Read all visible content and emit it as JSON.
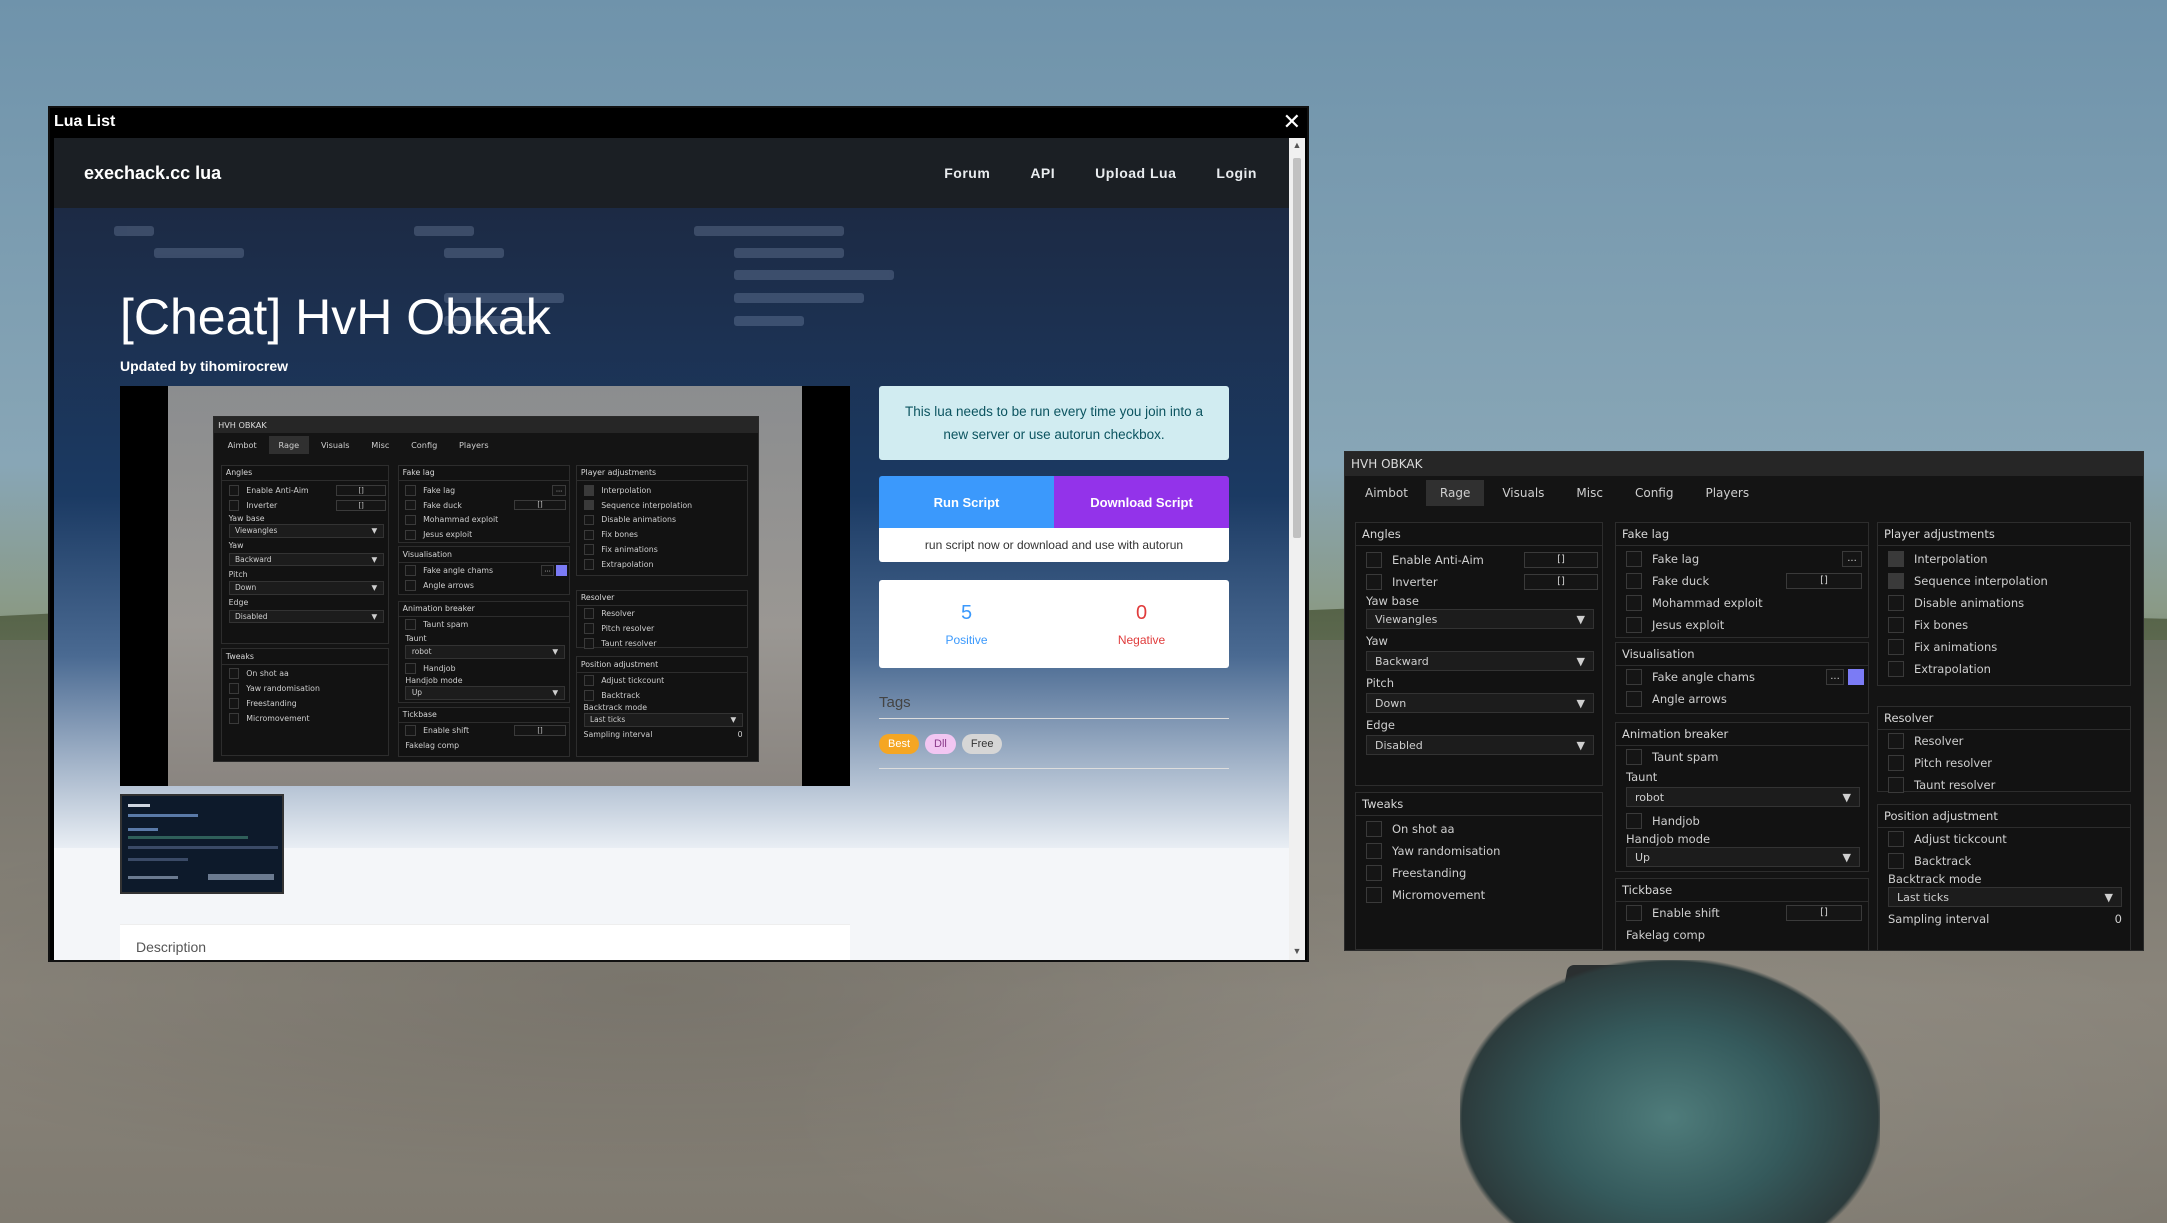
{
  "window": {
    "title": "Lua List"
  },
  "site": {
    "brand": "exechack.cc lua",
    "nav": [
      "Forum",
      "API",
      "Upload Lua",
      "Login"
    ],
    "script_title": "[Cheat] HvH Obkak",
    "updated_by": "Updated by tihomirocrew",
    "notice": "This lua needs to be run every time you join into a new server or use autorun checkbox.",
    "run_label": "Run Script",
    "download_label": "Download Script",
    "run_note": "run script now or download and use with autorun",
    "positive_count": "5",
    "positive_label": "Positive",
    "negative_count": "0",
    "negative_label": "Negative",
    "tags_title": "Tags",
    "tags": [
      {
        "label": "Best",
        "bg": "#f5a623",
        "fg": "#ffffff"
      },
      {
        "label": "Dll",
        "bg": "#f2c6f2",
        "fg": "#8a3a8a"
      },
      {
        "label": "Free",
        "bg": "#d6d6d6",
        "fg": "#333333"
      }
    ],
    "description_title": "Description"
  },
  "menu": {
    "title": "HVH OBKAK",
    "tabs": [
      "Aimbot",
      "Rage",
      "Visuals",
      "Misc",
      "Config",
      "Players"
    ],
    "active_tab": "Rage",
    "angles": {
      "title": "Angles",
      "enable_antiaim": "Enable Anti-Aim",
      "inverter": "Inverter",
      "yaw_base_label": "Yaw base",
      "yaw_base_value": "Viewangles",
      "yaw_label": "Yaw",
      "yaw_value": "Backward",
      "pitch_label": "Pitch",
      "pitch_value": "Down",
      "edge_label": "Edge",
      "edge_value": "Disabled"
    },
    "tweaks": {
      "title": "Tweaks",
      "items": [
        "On shot aa",
        "Yaw randomisation",
        "Freestanding",
        "Micromovement"
      ]
    },
    "fakelag": {
      "title": "Fake lag",
      "items": [
        "Fake lag",
        "Fake duck",
        "Mohammad exploit",
        "Jesus exploit"
      ]
    },
    "visualisation": {
      "title": "Visualisation",
      "items": [
        "Fake angle chams",
        "Angle arrows"
      ]
    },
    "animation_breaker": {
      "title": "Animation breaker",
      "taunt_spam": "Taunt spam",
      "taunt_label": "Taunt",
      "taunt_value": "robot",
      "handjob": "Handjob",
      "handjob_mode_label": "Handjob mode",
      "handjob_mode_value": "Up"
    },
    "tickbase": {
      "title": "Tickbase",
      "enable_shift": "Enable shift",
      "fakelag_comp": "Fakelag comp"
    },
    "player_adjustments": {
      "title": "Player adjustments",
      "items": [
        "Interpolation",
        "Sequence interpolation",
        "Disable animations",
        "Fix bones",
        "Fix animations",
        "Extrapolation"
      ]
    },
    "resolver": {
      "title": "Resolver",
      "items": [
        "Resolver",
        "Pitch resolver",
        "Taunt resolver"
      ]
    },
    "position_adjustment": {
      "title": "Position adjustment",
      "adjust_tickcount": "Adjust tickcount",
      "backtrack": "Backtrack",
      "backtrack_mode_label": "Backtrack mode",
      "backtrack_mode_value": "Last ticks",
      "sampling_interval_label": "Sampling interval",
      "sampling_interval_value": "0"
    },
    "more_glyph": "...",
    "key_glyph": "[]",
    "dropdown_glyph": "▼"
  }
}
